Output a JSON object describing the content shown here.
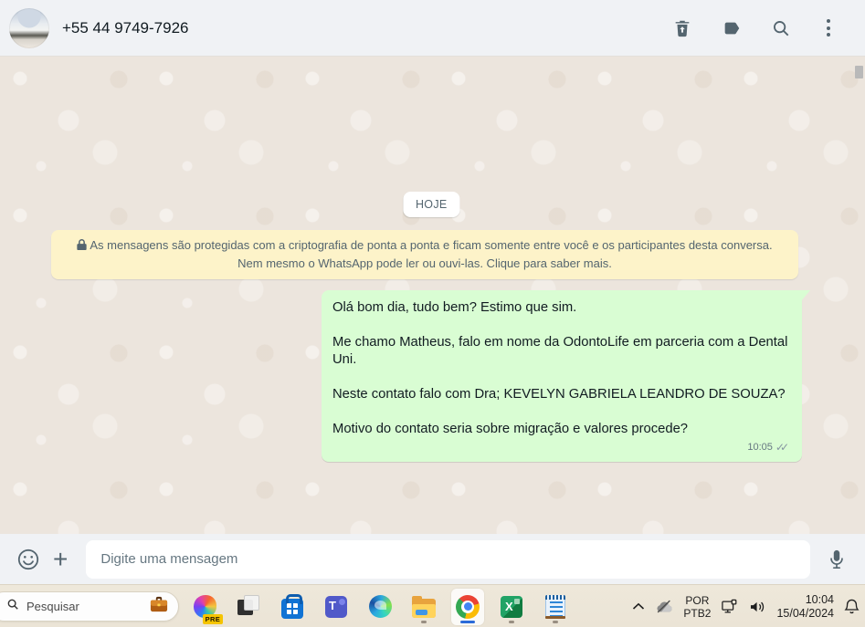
{
  "header": {
    "title": "+55 44 9749-7926",
    "icons": [
      "delete-trash-icon",
      "label-icon",
      "search-icon",
      "menu-kebab-icon"
    ]
  },
  "chat": {
    "date_badge": "HOJE",
    "encryption_notice": "As mensagens são protegidas com a criptografia de ponta a ponta e ficam somente entre você e os participantes desta conversa. Nem mesmo o WhatsApp pode ler ou ouvi-las. Clique para saber mais.",
    "messages": [
      "Olá bom dia, tudo bem? Estimo que sim.",
      "Me chamo Matheus, falo em nome da OdontoLife em parceria com a Dental Uni.",
      "Neste contato falo com Dra; KEVELYN GABRIELA LEANDRO DE SOUZA?",
      "Motivo do contato seria sobre migração e valores procede?"
    ],
    "time": "10:05",
    "ticks": "✓✓",
    "status": "delivered-double-gray-check"
  },
  "composer": {
    "placeholder": "Digite uma mensagem",
    "icons": [
      "emoji-smiley-icon",
      "attach-plus-icon",
      "microphone-icon"
    ]
  },
  "taskbar": {
    "search_placeholder": "Pesquisar",
    "search_icons": [
      "search-icon",
      "briefcase-icon"
    ],
    "copilot_badge": "PRE",
    "apps": [
      "copilot",
      "task-view",
      "microsoft-store",
      "microsoft-teams",
      "microsoft-edge",
      "file-explorer",
      "google-chrome",
      "excel",
      "notepad"
    ],
    "running_apps": [
      "file-explorer",
      "google-chrome",
      "excel",
      "notepad"
    ],
    "active_app": "google-chrome",
    "tray": {
      "icons": [
        "chevron-up-icon",
        "onedrive-paused-icon",
        "network-display-icon",
        "volume-icon",
        "bell-icon"
      ],
      "lang_line1": "POR",
      "lang_line2": "PTB2",
      "time": "10:04",
      "date": "15/04/2024"
    }
  },
  "colors": {
    "header_bg": "#f0f2f5",
    "chat_bg": "#ece5dd",
    "bubble_green": "#d9fdd3",
    "notice_yellow": "#fdf3c9",
    "icon_gray": "#54656f",
    "text_dark": "#111b21",
    "meta_gray": "#667781",
    "taskbar_bg": "#ebe4d6",
    "chrome_indicator_blue": "#2b6bd8"
  }
}
